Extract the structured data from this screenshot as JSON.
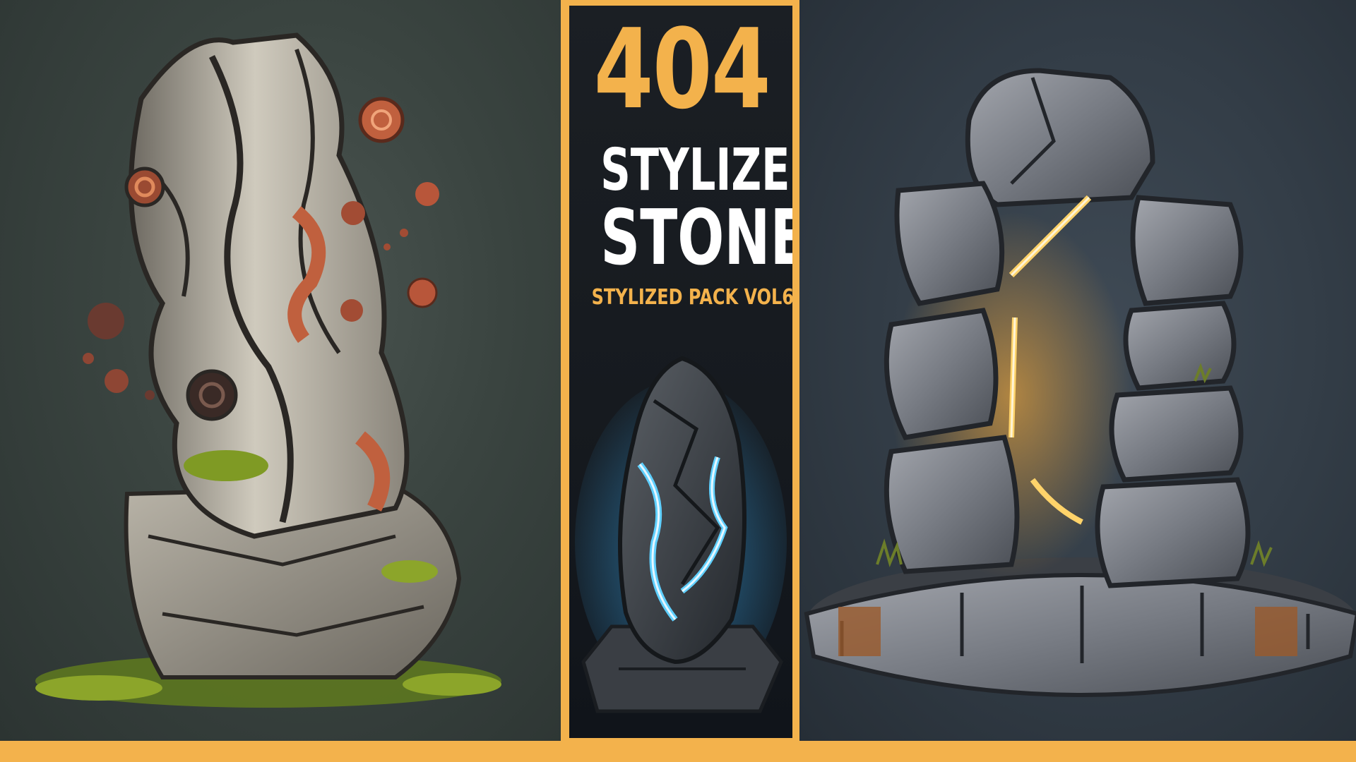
{
  "banner": {
    "count": "404",
    "title_line_1": "STYLIZED",
    "title_line_2": "STONE",
    "subtitle": "STYLIZED PACK VOL6"
  },
  "colors": {
    "accent": "#f3b24c",
    "title_text": "#ffffff",
    "center_panel": "#161a1f",
    "crystal_glow": "#3fb6ff",
    "portal_glow": "#ffb03a"
  },
  "images": {
    "left": "stylized-stone-pillar",
    "center": "glowing-blue-crystal-stone",
    "right": "stone-arch-portal"
  }
}
